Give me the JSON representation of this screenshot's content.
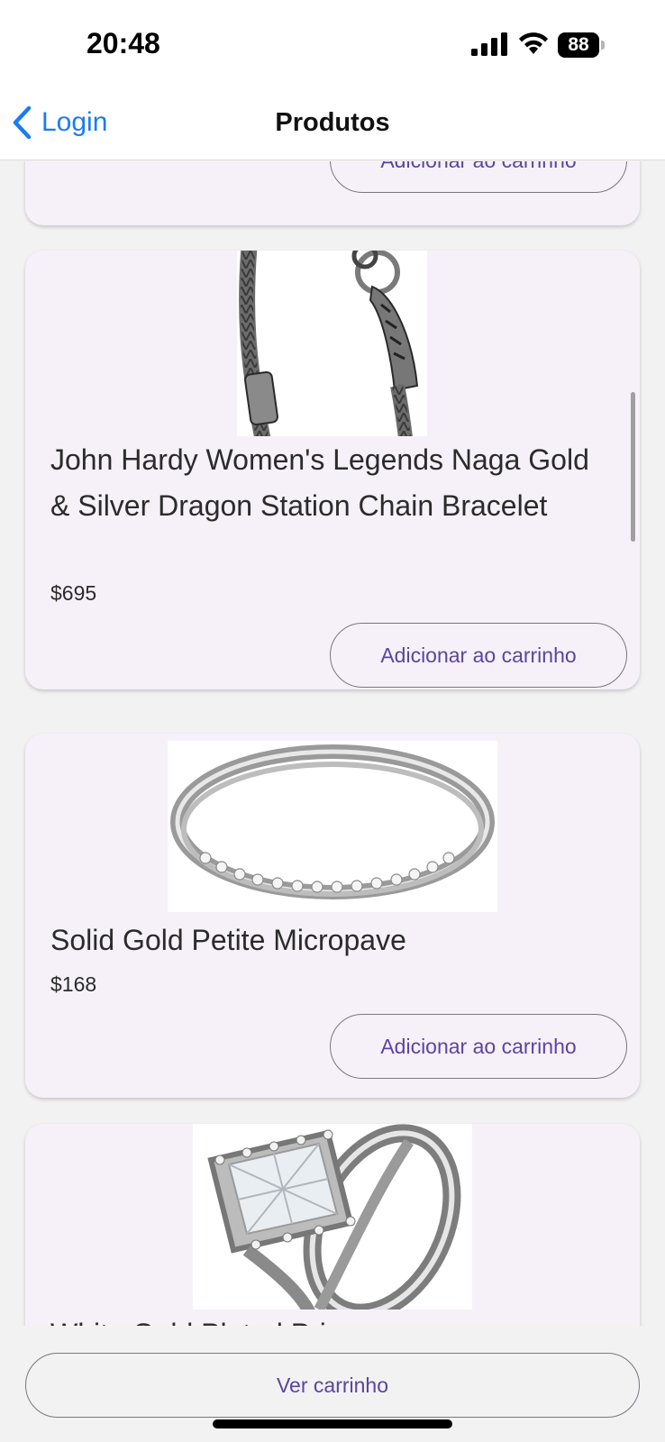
{
  "status_bar": {
    "time": "20:48",
    "battery": "88",
    "icons": [
      "signal-icon",
      "wifi-icon",
      "battery-icon"
    ]
  },
  "nav": {
    "back_label": "Login",
    "title": "Produtos",
    "accent_color": "#1a7cf0"
  },
  "products": [
    {
      "title": "",
      "price": "",
      "button_label": "Adicionar ao carrinho"
    },
    {
      "title": "John Hardy Women's Legends Naga Gold & Silver Dragon Station Chain Bracelet",
      "price": "$695",
      "button_label": "Adicionar ao carrinho",
      "image": "bracelet-image"
    },
    {
      "title": "Solid Gold Petite Micropave",
      "price": "$168",
      "button_label": "Adicionar ao carrinho",
      "image": "ring-image"
    },
    {
      "title": "White Gold Plated Princess",
      "price": "",
      "button_label": "",
      "image": "diamond-ring-image"
    }
  ],
  "footer": {
    "cart_button_label": "Ver carrinho"
  },
  "colors": {
    "card_background": "#f6f1f8",
    "button_text": "#5a45a0"
  }
}
